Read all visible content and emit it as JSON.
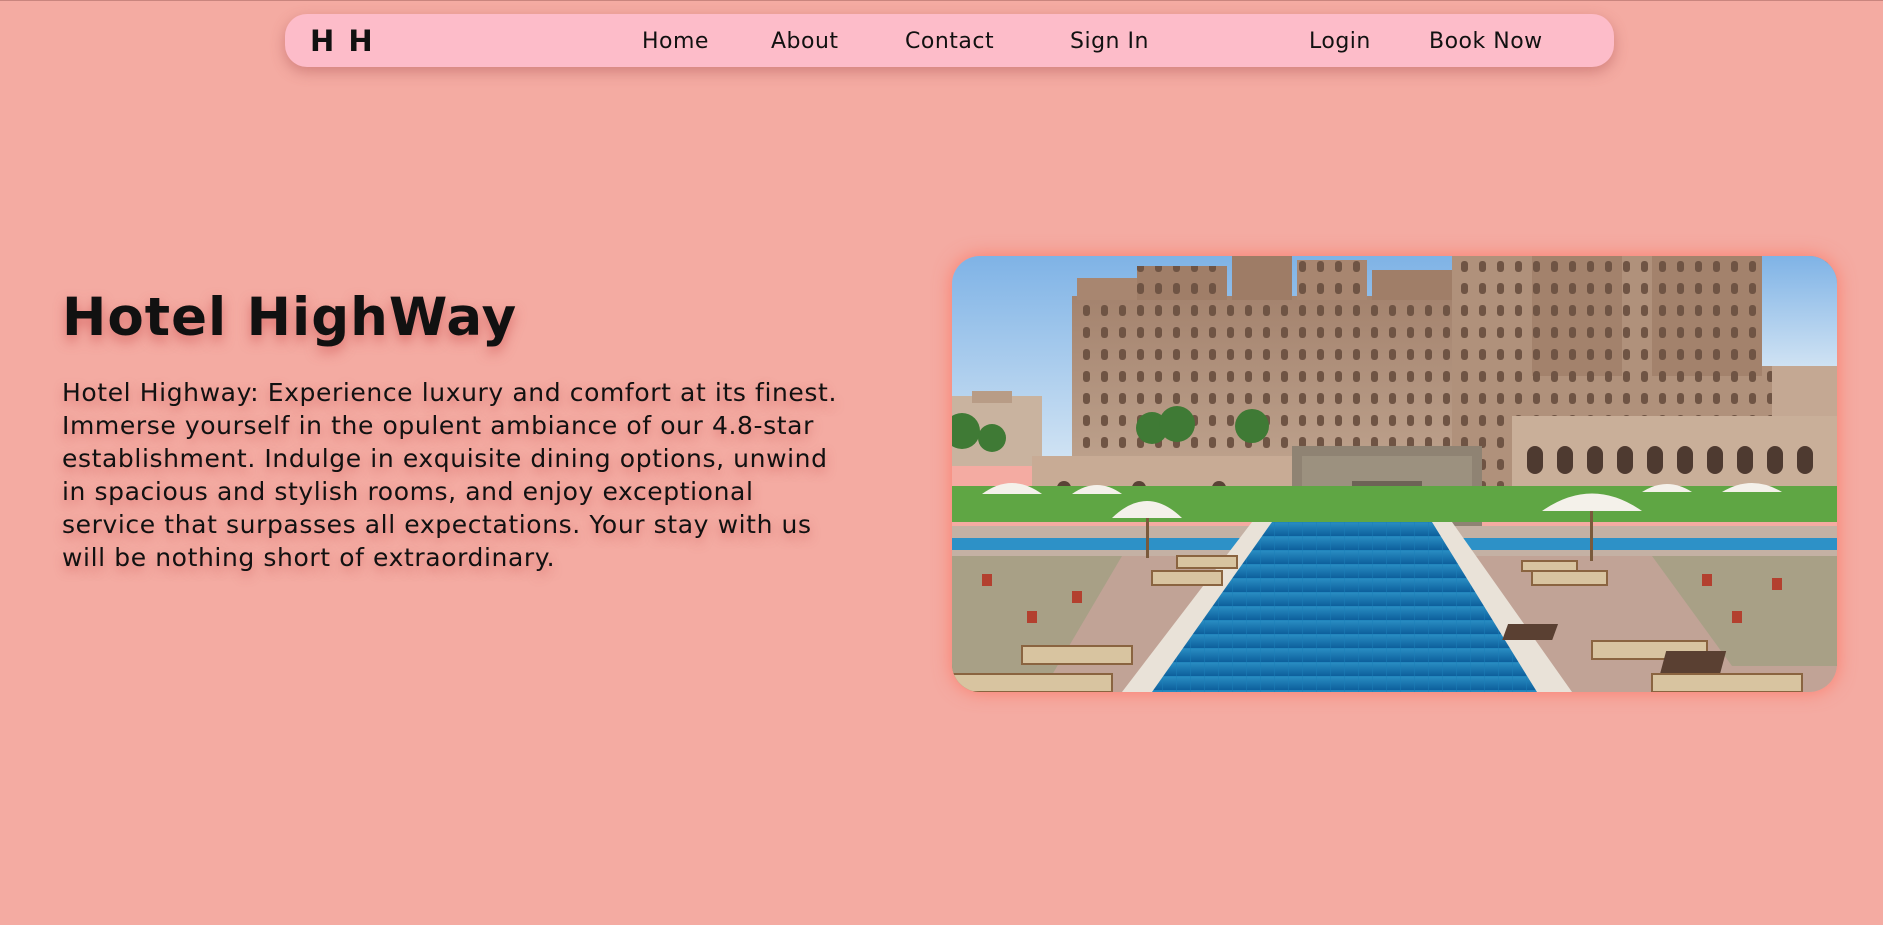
{
  "nav": {
    "logo": "H H",
    "links": [
      {
        "label": "Home"
      },
      {
        "label": "About"
      },
      {
        "label": "Contact"
      },
      {
        "label": "Sign In"
      }
    ],
    "login": "Login",
    "book_now": "Book Now"
  },
  "hero": {
    "title": "Hotel HighWay",
    "description": "Hotel Highway: Experience luxury and comfort at its finest. Immerse yourself in the opulent ambiance of our 4.8-star establishment. Indulge in exquisite dining options, unwind in spacious and stylish rooms, and enjoy exceptional service that surpasses all expectations. Your stay with us will be nothing short of extraordinary.",
    "image": "hotel-palace-pool-photo"
  },
  "colors": {
    "page_background": "#f4aba2",
    "navbar_background": "#fdbcc9",
    "text": "#111111"
  }
}
